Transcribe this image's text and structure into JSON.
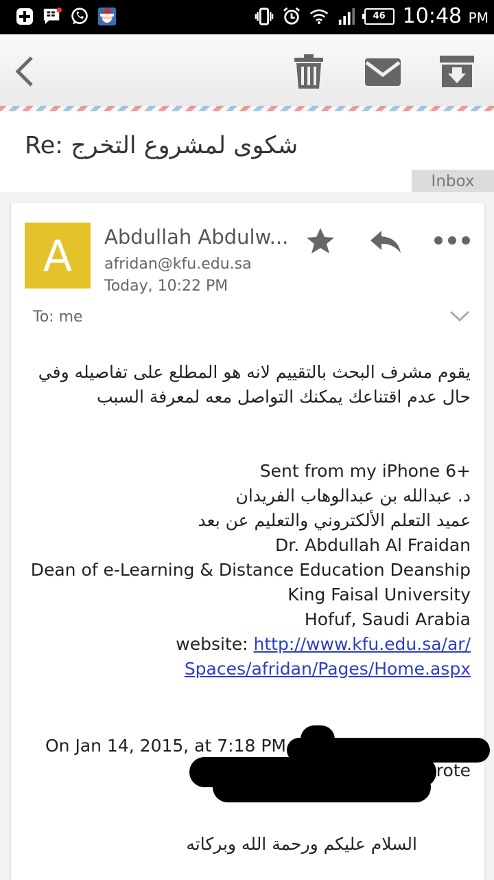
{
  "status_bar": {
    "icons_left": [
      "add-notification-icon",
      "bbm-icon",
      "whatsapp-icon",
      "app-santa-icon"
    ],
    "icons_right": [
      "vibrate-icon",
      "alarm-icon",
      "wifi-icon",
      "signal-icon"
    ],
    "battery": "46",
    "time": "10:48",
    "ampm": "PM"
  },
  "toolbar": {
    "back_icon": "back-chevron-icon",
    "delete_icon": "trash-icon",
    "mark_unread_icon": "envelope-icon",
    "archive_icon": "archive-icon"
  },
  "email": {
    "subject": "Re: شكوى لمشروع التخرج",
    "label": "Inbox",
    "sender_initial": "A",
    "sender_name": "Abdullah Abdulw...",
    "sender_email": "afridan@kfu.edu.sa",
    "time": "Today, 10:22 PM",
    "to": "To: me",
    "body_paragraph": "يقوم مشرف البحث بالتقييم لانه هو المطلع على تفاصيله وفي حال عدم اقتناعك يمكنك التواصل معه لمعرفة السبب",
    "sent_from": "Sent from my iPhone 6+",
    "signature": {
      "line_ar_1": "د. عبدالله بن عبدالوهاب الفريدان",
      "line_ar_2": "عميد التعلم الألكتروني والتعليم عن بعد",
      "line_en_1": "Dr. Abdullah Al Fraidan",
      "line_en_2": "Dean of e-Learning & Distance Education Deanship",
      "line_en_3": "King Faisal University",
      "line_en_4": "Hofuf, Saudi Arabia",
      "website_label": "website: ",
      "website_url_1": "http://www.kfu.edu.sa/ar/",
      "website_url_2": "Spaces/afridan/Pages/Home.aspx"
    },
    "quote_header_1": "On Jan 14, 2015, at 7:18 PM,",
    "quote_header_2": "wrote",
    "quote_greeting": "السلام عليكم ورحمة الله وبركاته"
  },
  "colors": {
    "avatar": "#e3c22c",
    "link": "#2a3ec7",
    "icon_gray": "#666666"
  }
}
